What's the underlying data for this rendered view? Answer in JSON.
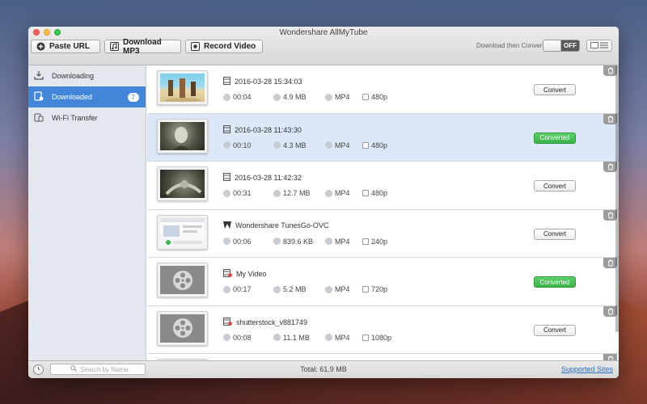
{
  "app": {
    "title": "Wondershare AllMyTube"
  },
  "toolbar": {
    "paste_url": "Paste URL",
    "download_mp3": "Download MP3",
    "record_video": "Record Video",
    "convert_label": "Download then Convert",
    "toggle_state": "OFF"
  },
  "sidebar": {
    "items": [
      {
        "label": "Downloading",
        "icon": "download-icon"
      },
      {
        "label": "Downloaded",
        "icon": "downloaded-icon",
        "badge": "7"
      },
      {
        "label": "Wi-Fi Transfer",
        "icon": "wifi-transfer-icon"
      }
    ]
  },
  "videos": [
    {
      "title": "2016-03-28 15:34:03",
      "duration": "00:04",
      "size": "4.9 MB",
      "format": "MP4",
      "resolution": "480p",
      "action": "Convert",
      "thumb": "beach",
      "type_icon": "film-icon"
    },
    {
      "title": "2016-03-28 11:43:30",
      "duration": "00:10",
      "size": "4.3 MB",
      "format": "MP4",
      "resolution": "480p",
      "action": "Converted",
      "thumb": "dark",
      "type_icon": "film-icon"
    },
    {
      "title": "2016-03-28 11:42:32",
      "duration": "00:31",
      "size": "12.7 MB",
      "format": "MP4",
      "resolution": "480p",
      "action": "Convert",
      "thumb": "dark2",
      "type_icon": "film-icon"
    },
    {
      "title": "Wondershare TunesGo-OVC",
      "duration": "00:06",
      "size": "839.6 KB",
      "format": "MP4",
      "resolution": "240p",
      "action": "Convert",
      "thumb": "web",
      "type_icon": "wondershare-icon"
    },
    {
      "title": "My Video",
      "duration": "00:17",
      "size": "5.2 MB",
      "format": "MP4",
      "resolution": "720p",
      "action": "Converted",
      "thumb": "film",
      "type_icon": "film-error-icon"
    },
    {
      "title": "shutterstock_v881749",
      "duration": "00:08",
      "size": "11.1 MB",
      "format": "MP4",
      "resolution": "1080p",
      "action": "Convert",
      "thumb": "film",
      "type_icon": "film-error-icon"
    },
    {
      "title": "",
      "duration": "",
      "size": "",
      "format": "",
      "resolution": "",
      "action": "",
      "thumb": "film",
      "type_icon": ""
    }
  ],
  "status": {
    "search_placeholder": "Search by Name",
    "total": "Total: 61.9 MB",
    "supported_sites": "Supported Sites"
  },
  "colors": {
    "accent": "#4186d8",
    "converted_green": "#39b348"
  }
}
